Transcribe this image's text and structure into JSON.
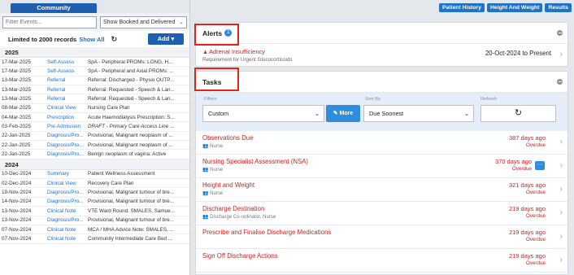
{
  "left": {
    "tab": "Community",
    "filter_placeholder": "Filter Events...",
    "show_select": "Show Booked and Delivered",
    "limit_text": "Limited to 2000 records",
    "show_all": "Show All",
    "add_label": "Add",
    "groups": [
      {
        "year": "2025",
        "rows": [
          {
            "date": "17-Mar-2025",
            "type": "Self-Assess",
            "desc": "SpA - Peripheral PROMs: LONG, H..."
          },
          {
            "date": "17-Mar-2025",
            "type": "Self-Assess",
            "desc": "SpA - Peripheral and Axial PROMs: ..."
          },
          {
            "date": "13-Mar-2025",
            "type": "Referral",
            "desc": "Referral: Discharged - Physio OUTP..."
          },
          {
            "date": "13-Mar-2025",
            "type": "Referral",
            "desc": "Referral: Requested - Speech & Lan..."
          },
          {
            "date": "13-Mar-2025",
            "type": "Referral",
            "desc": "Referral: Requested - Speech & Lan..."
          },
          {
            "date": "08-Mar-2025",
            "type": "Clinical View",
            "desc": "Nursing Care Plan"
          },
          {
            "date": "04-Mar-2025",
            "type": "Prescription",
            "desc": "Acute Haemodialysis Prescription: S..."
          },
          {
            "date": "03-Feb-2025",
            "type": "Pre-Admission",
            "desc": "DRAFT - Primary Care Access Line ...",
            "italic": true
          },
          {
            "date": "22-Jan-2025",
            "type": "Diagnosis/Pro...",
            "desc": "Provisional, Malignant neoplasm of ..."
          },
          {
            "date": "22-Jan-2025",
            "type": "Diagnosis/Pro...",
            "desc": "Provisional, Malignant neoplasm of ..."
          },
          {
            "date": "22-Jan-2025",
            "type": "Diagnosis/Pro...",
            "desc": "Benign neoplasm of vagina: Active"
          }
        ]
      },
      {
        "year": "2024",
        "rows": [
          {
            "date": "10-Dec-2024",
            "type": "Summary",
            "desc": "Patient Wellness Assessment"
          },
          {
            "date": "02-Dec-2024",
            "type": "Clinical View",
            "desc": "Recovery Care Plan"
          },
          {
            "date": "19-Nov-2024",
            "type": "Diagnosis/Pro...",
            "desc": "Provisional, Malignant tumour of bre..."
          },
          {
            "date": "14-Nov-2024",
            "type": "Diagnosis/Pro...",
            "desc": "Provisional, Malignant tumour of bre..."
          },
          {
            "date": "13-Nov-2024",
            "type": "Clinical Note",
            "desc": "VTE Ward Round: SMALES, Samue..."
          },
          {
            "date": "13-Nov-2024",
            "type": "Diagnosis/Pro...",
            "desc": "Provisional, Malignant tumour of bre..."
          },
          {
            "date": "07-Nov-2024",
            "type": "Clinical Note",
            "desc": "MCA / MHA Advice Note: SMALES, ..."
          },
          {
            "date": "07-Nov-2024",
            "type": "Clinical Note",
            "desc": "Community Intermediate Care Bed ..."
          }
        ]
      }
    ]
  },
  "top_buttons": [
    "Patient History",
    "Height And Weight",
    "Results"
  ],
  "alerts": {
    "title": "Alerts",
    "count": "1",
    "item": {
      "title": "Adrenal Insufficiency",
      "sub": "Requirement for Urgent Glucocorticoids",
      "range": "20-Oct-2024 to Present"
    }
  },
  "tasks": {
    "title": "Tasks",
    "filters_label": "Filters",
    "filters_value": "Custom",
    "more_label": "More",
    "sort_label": "Sort By",
    "sort_value": "Due Soonest",
    "refresh_label": "Refresh",
    "items": [
      {
        "name": "Observations Due",
        "role": "Nurse",
        "days": "387 days ago",
        "status": "Overdue"
      },
      {
        "name": "Nursing Specialist Assessment (NSA)",
        "role": "Nurse",
        "days": "370 days ago",
        "status": "Overdue",
        "menu": true
      },
      {
        "name": "Height and Weight",
        "role": "Nurse",
        "days": "321 days ago",
        "status": "Overdue"
      },
      {
        "name": "Discharge Destination",
        "role": "Discharge Co-ordinator, Nurse",
        "days": "219 days ago",
        "status": "Overdue"
      },
      {
        "name": "Prescribe and Finalise Discharge Medications",
        "role": "",
        "days": "219 days ago",
        "status": "Overdue"
      },
      {
        "name": "Sign Off Discharge Actions",
        "role": "",
        "days": "219 days ago",
        "status": "Overdue"
      }
    ]
  },
  "colors": {
    "accent": "#1f5fb0",
    "alert_red": "#d12020",
    "highlight_box": "#e0241b"
  }
}
